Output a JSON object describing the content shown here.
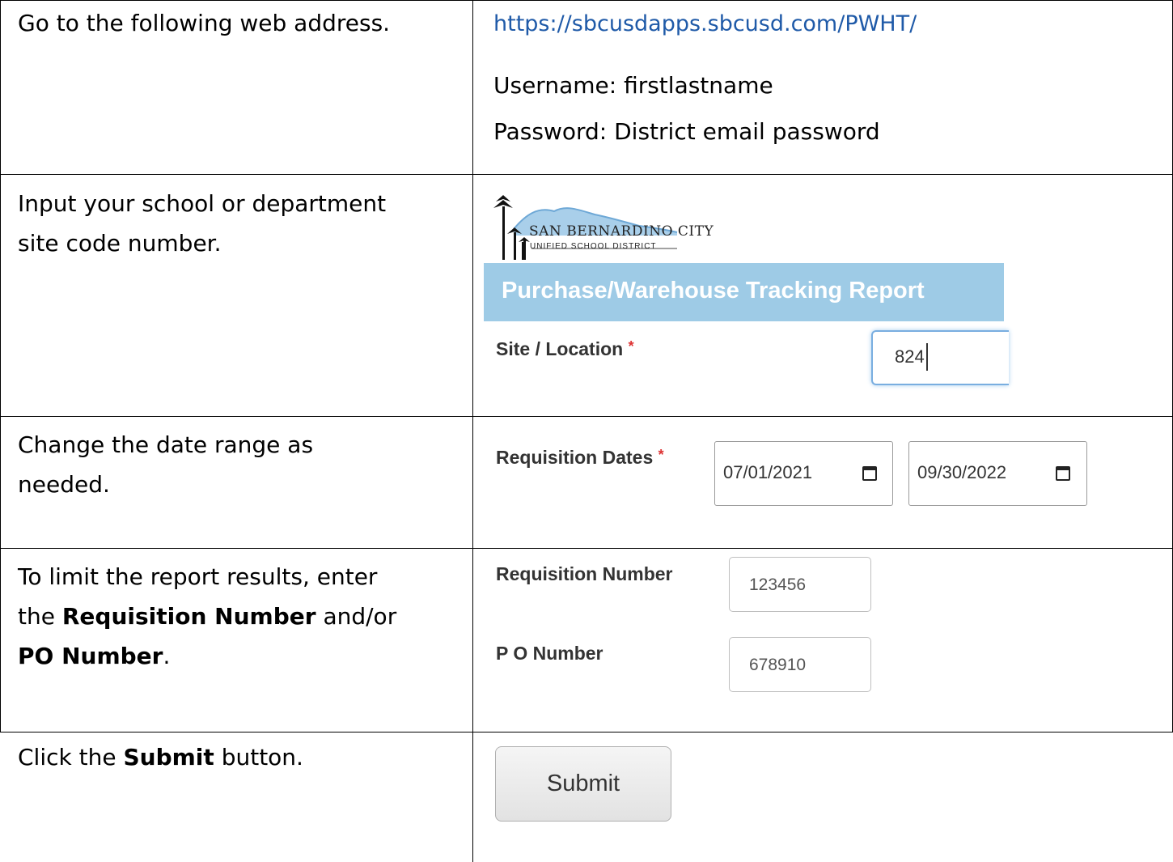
{
  "rows": [
    {
      "instruction": "Go to the following web address.",
      "url": "https://sbcusdapps.sbcusd.com/PWHT/",
      "username_line": "Username: firstlastname",
      "password_line": "Password: District email password"
    },
    {
      "instruction_line1": "Input your school or department",
      "instruction_line2": "site code number.",
      "logo_line1": "SAN BERNARDINO CITY",
      "logo_line2": "UNIFIED SCHOOL DISTRICT",
      "banner_title": "Purchase/Warehouse Tracking Report",
      "site_label": "Site / Location",
      "required_mark": "*",
      "site_value": "824"
    },
    {
      "instruction_line1": "Change the date range as",
      "instruction_line2": "needed.",
      "dates_label": "Requisition Dates",
      "required_mark": "*",
      "start_date": "07/01/2021",
      "end_date": "09/30/2022"
    },
    {
      "line1": "To limit the report results, enter",
      "line2_pre": "the ",
      "line2_bold": "Requisition Number",
      "line2_post": " and/or",
      "line3_bold": "PO Number",
      "line3_post": ".",
      "req_label": "Requisition Number",
      "req_value": "123456",
      "po_label": "P O Number",
      "po_value": "678910"
    },
    {
      "pre": "Click the ",
      "bold": "Submit",
      "post": " button.",
      "button_label": "Submit"
    }
  ],
  "colors": {
    "link": "#1f5aa8",
    "banner": "#9ecbe6",
    "required": "#dd3333"
  }
}
